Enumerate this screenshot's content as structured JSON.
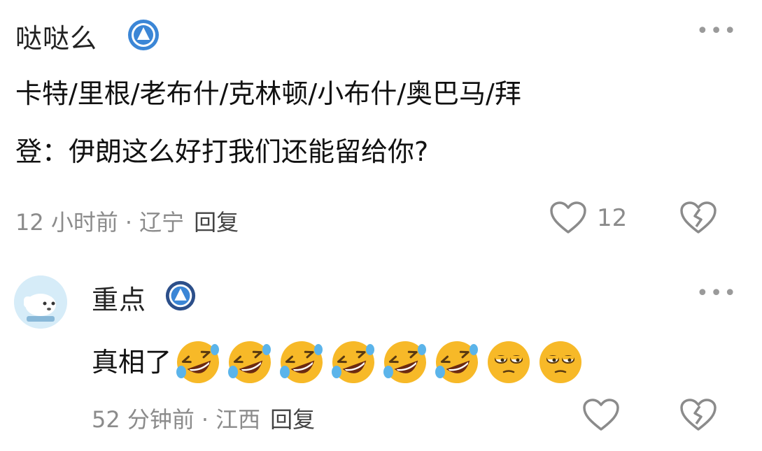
{
  "comment1": {
    "username": "哒哒么",
    "text_line1": "卡特/里根/老布什/克林顿/小布什/奥巴马/拜",
    "text_line2": "登：伊朗这么好打我们还能留给你?",
    "time": "12 小时前",
    "location": "辽宁",
    "reply_label": "回复",
    "like_count": "12",
    "more_icon": "more-dots-icon",
    "badge_icon": "level-badge-icon",
    "like_icon": "heart-outline-icon",
    "dislike_icon": "broken-heart-icon"
  },
  "comment2": {
    "username": "重点",
    "text": "真相了",
    "emojis": [
      "rofl",
      "rofl",
      "rofl",
      "rofl",
      "rofl",
      "rofl",
      "sleepy",
      "sleepy"
    ],
    "time": "52 分钟前",
    "location": "江西",
    "reply_label": "回复",
    "avatar_icon": "avatar-dog-icon"
  },
  "colors": {
    "meta": "#8b8b8b",
    "badge": "#3b86d6",
    "emoji": "#f7b928"
  }
}
